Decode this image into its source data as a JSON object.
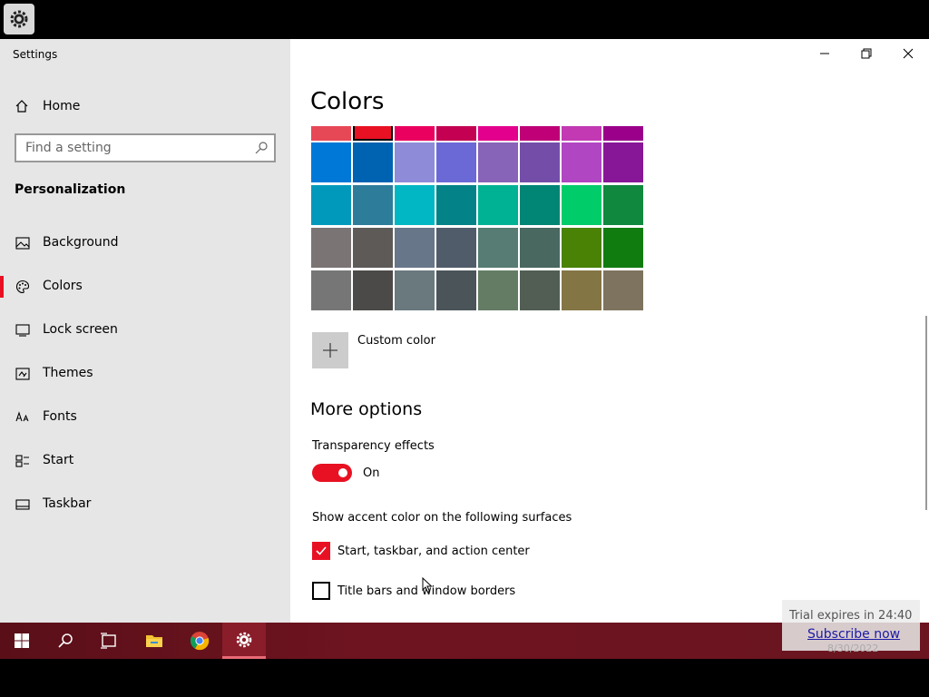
{
  "app": {
    "title": "Settings"
  },
  "sidebar": {
    "home_label": "Home",
    "search_placeholder": "Find a setting",
    "section_title": "Personalization",
    "items": [
      {
        "label": "Background",
        "icon": "picture-icon"
      },
      {
        "label": "Colors",
        "icon": "palette-icon",
        "active": true
      },
      {
        "label": "Lock screen",
        "icon": "lock-screen-icon"
      },
      {
        "label": "Themes",
        "icon": "themes-icon"
      },
      {
        "label": "Fonts",
        "icon": "fonts-icon"
      },
      {
        "label": "Start",
        "icon": "start-icon"
      },
      {
        "label": "Taskbar",
        "icon": "taskbar-icon"
      }
    ]
  },
  "main": {
    "title": "Colors",
    "swatch_rows": [
      [
        "#e74856",
        "#e81123",
        "#ea005e",
        "#c30052",
        "#e3008c",
        "#bf0077",
        "#c239b3",
        "#9a0089"
      ],
      [
        "#0078d7",
        "#0063b1",
        "#8e8cd8",
        "#6b69d6",
        "#8764b8",
        "#744da9",
        "#b146c2",
        "#881798"
      ],
      [
        "#0099bc",
        "#2d7d9a",
        "#00b7c3",
        "#038387",
        "#00b294",
        "#018574",
        "#00cc6a",
        "#10893e"
      ],
      [
        "#7a7574",
        "#5d5a58",
        "#68768a",
        "#515c6b",
        "#567c73",
        "#486860",
        "#498205",
        "#107c10"
      ],
      [
        "#767676",
        "#4c4a48",
        "#69797e",
        "#4a5459",
        "#647c64",
        "#525e54",
        "#847545",
        "#7e735f"
      ]
    ],
    "selected_swatch": "#e81123",
    "custom_color_label": "Custom color",
    "more_options_title": "More options",
    "transparency_label": "Transparency effects",
    "transparency_state": "On",
    "surfaces_label": "Show accent color on the following surfaces",
    "check_start_label": "Start, taskbar, and action center",
    "check_start_checked": true,
    "check_title_label": "Title bars and window borders",
    "check_title_checked": false
  },
  "taskbar": {
    "buttons": [
      "windows-start-icon",
      "search-icon",
      "task-view-icon",
      "file-explorer-icon",
      "chrome-icon",
      "settings-gear-icon"
    ]
  },
  "overlay": {
    "trial_text": "Trial expires in 24:40",
    "subscribe_text": "Subscribe now",
    "date_text": "8/30/2022"
  },
  "colors": {
    "accent": "#e81123",
    "sidebar_bg": "#e6e6e6",
    "taskbar_bg": "#6e1420"
  }
}
